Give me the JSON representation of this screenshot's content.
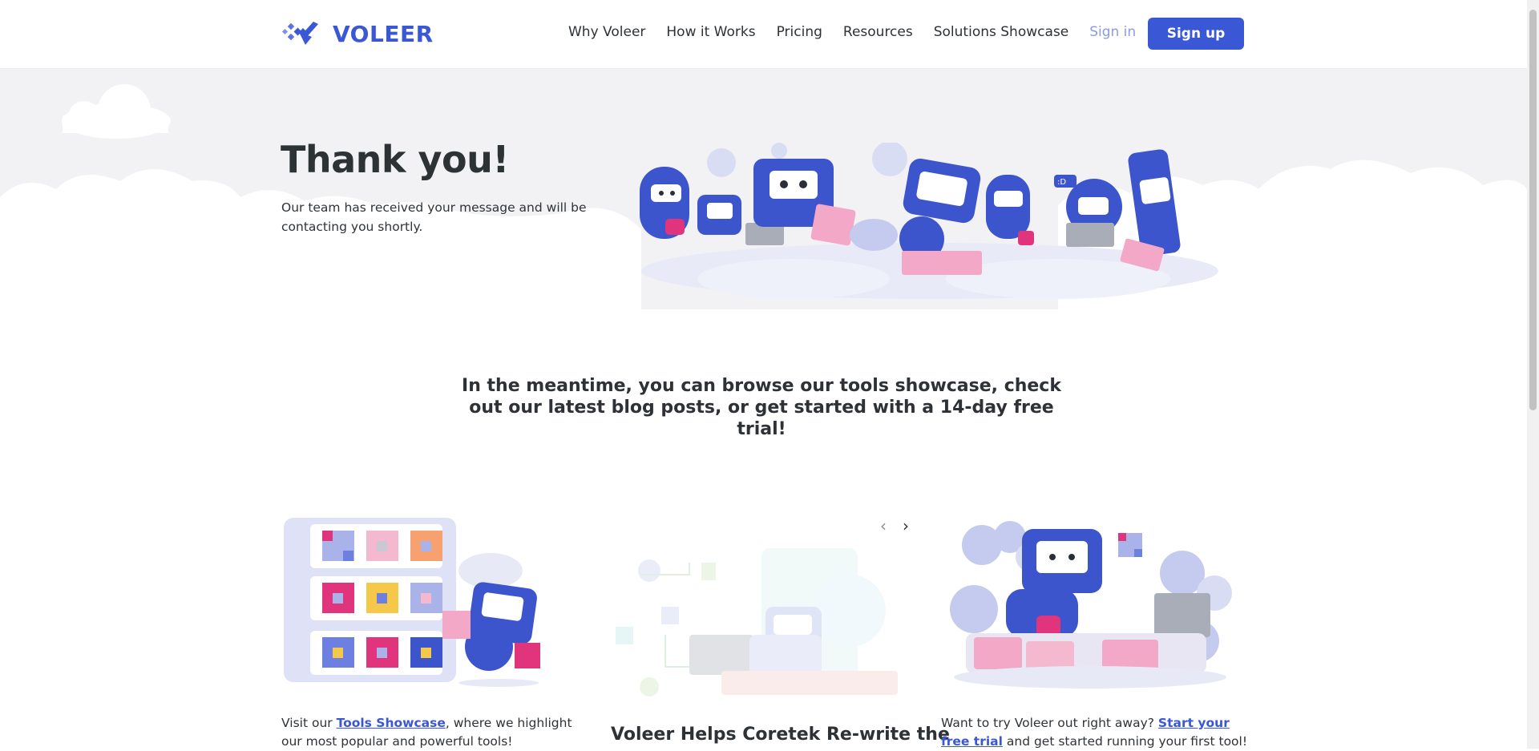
{
  "header": {
    "logo_text": "VOLEER",
    "nav": [
      "Why Voleer",
      "How it Works",
      "Pricing",
      "Resources",
      "Solutions Showcase"
    ],
    "signin_label": "Sign in",
    "signup_label": "Sign up"
  },
  "hero": {
    "title": "Thank you!",
    "message": "Our team has received your message and will be contacting you shortly."
  },
  "meantime": {
    "text": "In the meantime, you can browse our tools showcase, check out our latest blog posts, or get started with a 14-day free trial!"
  },
  "cards": {
    "showcase": {
      "prefix": "Visit our ",
      "link": "Tools Showcase",
      "suffix": ", where we highlight our most popular and powerful tools!"
    },
    "blog": {
      "prev_icon": "chevron-left-icon",
      "next_icon": "chevron-right-icon",
      "title": "Voleer Helps Coretek Re-write the"
    },
    "trial": {
      "prefix": "Want to try Voleer out right away? ",
      "link": "Start your free trial",
      "suffix": " and get started running your first tool!"
    }
  },
  "colors": {
    "brand": "#3a57d6",
    "signin": "#8b9be6",
    "hero_bg": "#f2f2f4"
  }
}
